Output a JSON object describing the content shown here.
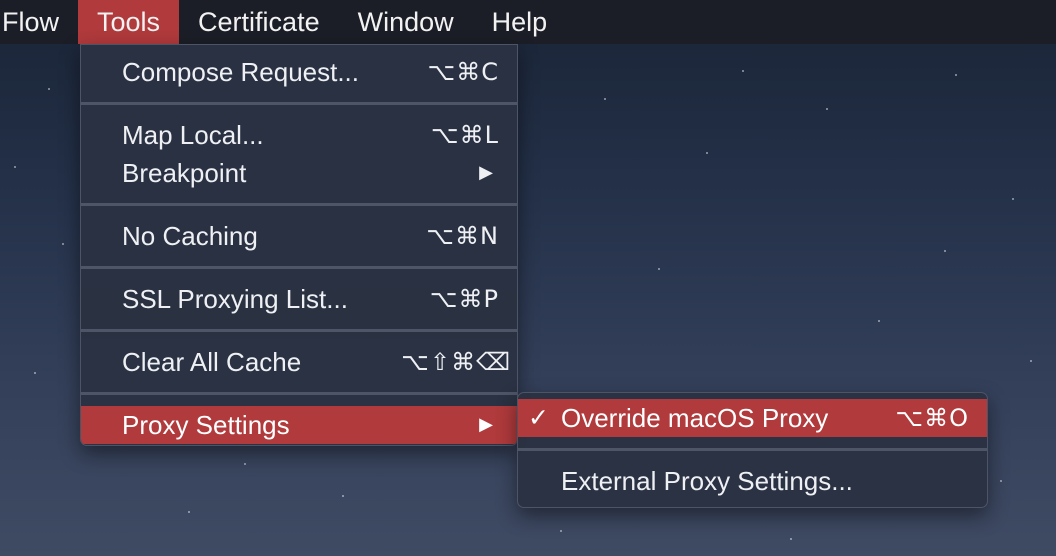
{
  "menubar": {
    "items": [
      {
        "label": "Flow"
      },
      {
        "label": "Tools"
      },
      {
        "label": "Certificate"
      },
      {
        "label": "Window"
      },
      {
        "label": "Help"
      }
    ],
    "active": "Tools",
    "active_color": "#b03a3c"
  },
  "tools_menu": {
    "compose_request": {
      "label": "Compose Request...",
      "shortcut": "⌥⌘C"
    },
    "map_local": {
      "label": "Map Local...",
      "shortcut": "⌥⌘L"
    },
    "breakpoint": {
      "label": "Breakpoint",
      "submenu_icon": "triangle-right-icon"
    },
    "no_caching": {
      "label": "No Caching",
      "shortcut": "⌥⌘N"
    },
    "ssl_proxying_list": {
      "label": "SSL Proxying List...",
      "shortcut": "⌥⌘P"
    },
    "clear_all_cache": {
      "label": "Clear All Cache",
      "shortcut": "⌥⇧⌘⌫"
    },
    "proxy_settings": {
      "label": "Proxy Settings",
      "submenu_icon": "triangle-right-icon",
      "highlighted": true
    }
  },
  "proxy_submenu": {
    "override_macos_proxy": {
      "label": "Override macOS Proxy",
      "shortcut": "⌥⌘O",
      "checked": true,
      "check_glyph": "✓"
    },
    "external_proxy_settings": {
      "label": "External Proxy Settings..."
    }
  },
  "colors": {
    "highlight": "#b03a3c",
    "menubar_bg": "#1b1e26",
    "menu_bg": "#2a3242"
  }
}
